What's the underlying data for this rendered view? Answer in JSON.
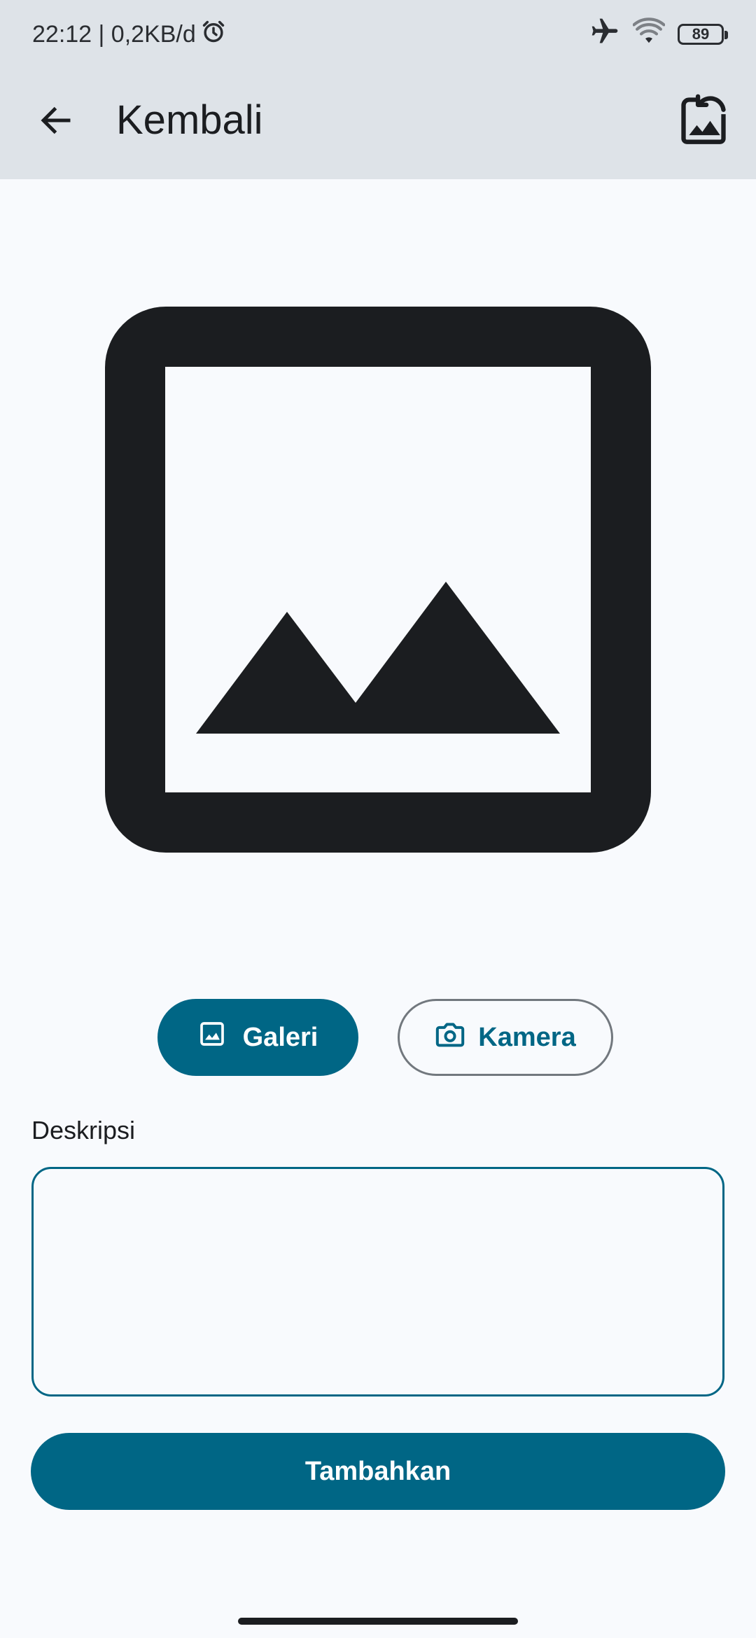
{
  "status_bar": {
    "time_and_speed": "22:12 | 0,2KB/d",
    "battery_level": "89",
    "icons": [
      "alarm-icon",
      "airplane-icon",
      "wifi-icon",
      "battery-icon"
    ]
  },
  "app_bar": {
    "title": "Kembali",
    "back_icon": "arrow-left-icon",
    "action_icon": "image-reset-icon"
  },
  "preview": {
    "icon": "image-placeholder-icon"
  },
  "buttons": {
    "gallery_label": "Galeri",
    "gallery_icon": "image-icon",
    "camera_label": "Kamera",
    "camera_icon": "camera-icon",
    "submit_label": "Tambahkan"
  },
  "form": {
    "description_label": "Deskripsi",
    "description_value": "",
    "description_placeholder": ""
  },
  "colors": {
    "primary": "#006685",
    "app_bar_bg": "#dee3e8",
    "background": "#f8fafd",
    "icon_dark": "#1b1d20",
    "outline": "#72787e"
  }
}
